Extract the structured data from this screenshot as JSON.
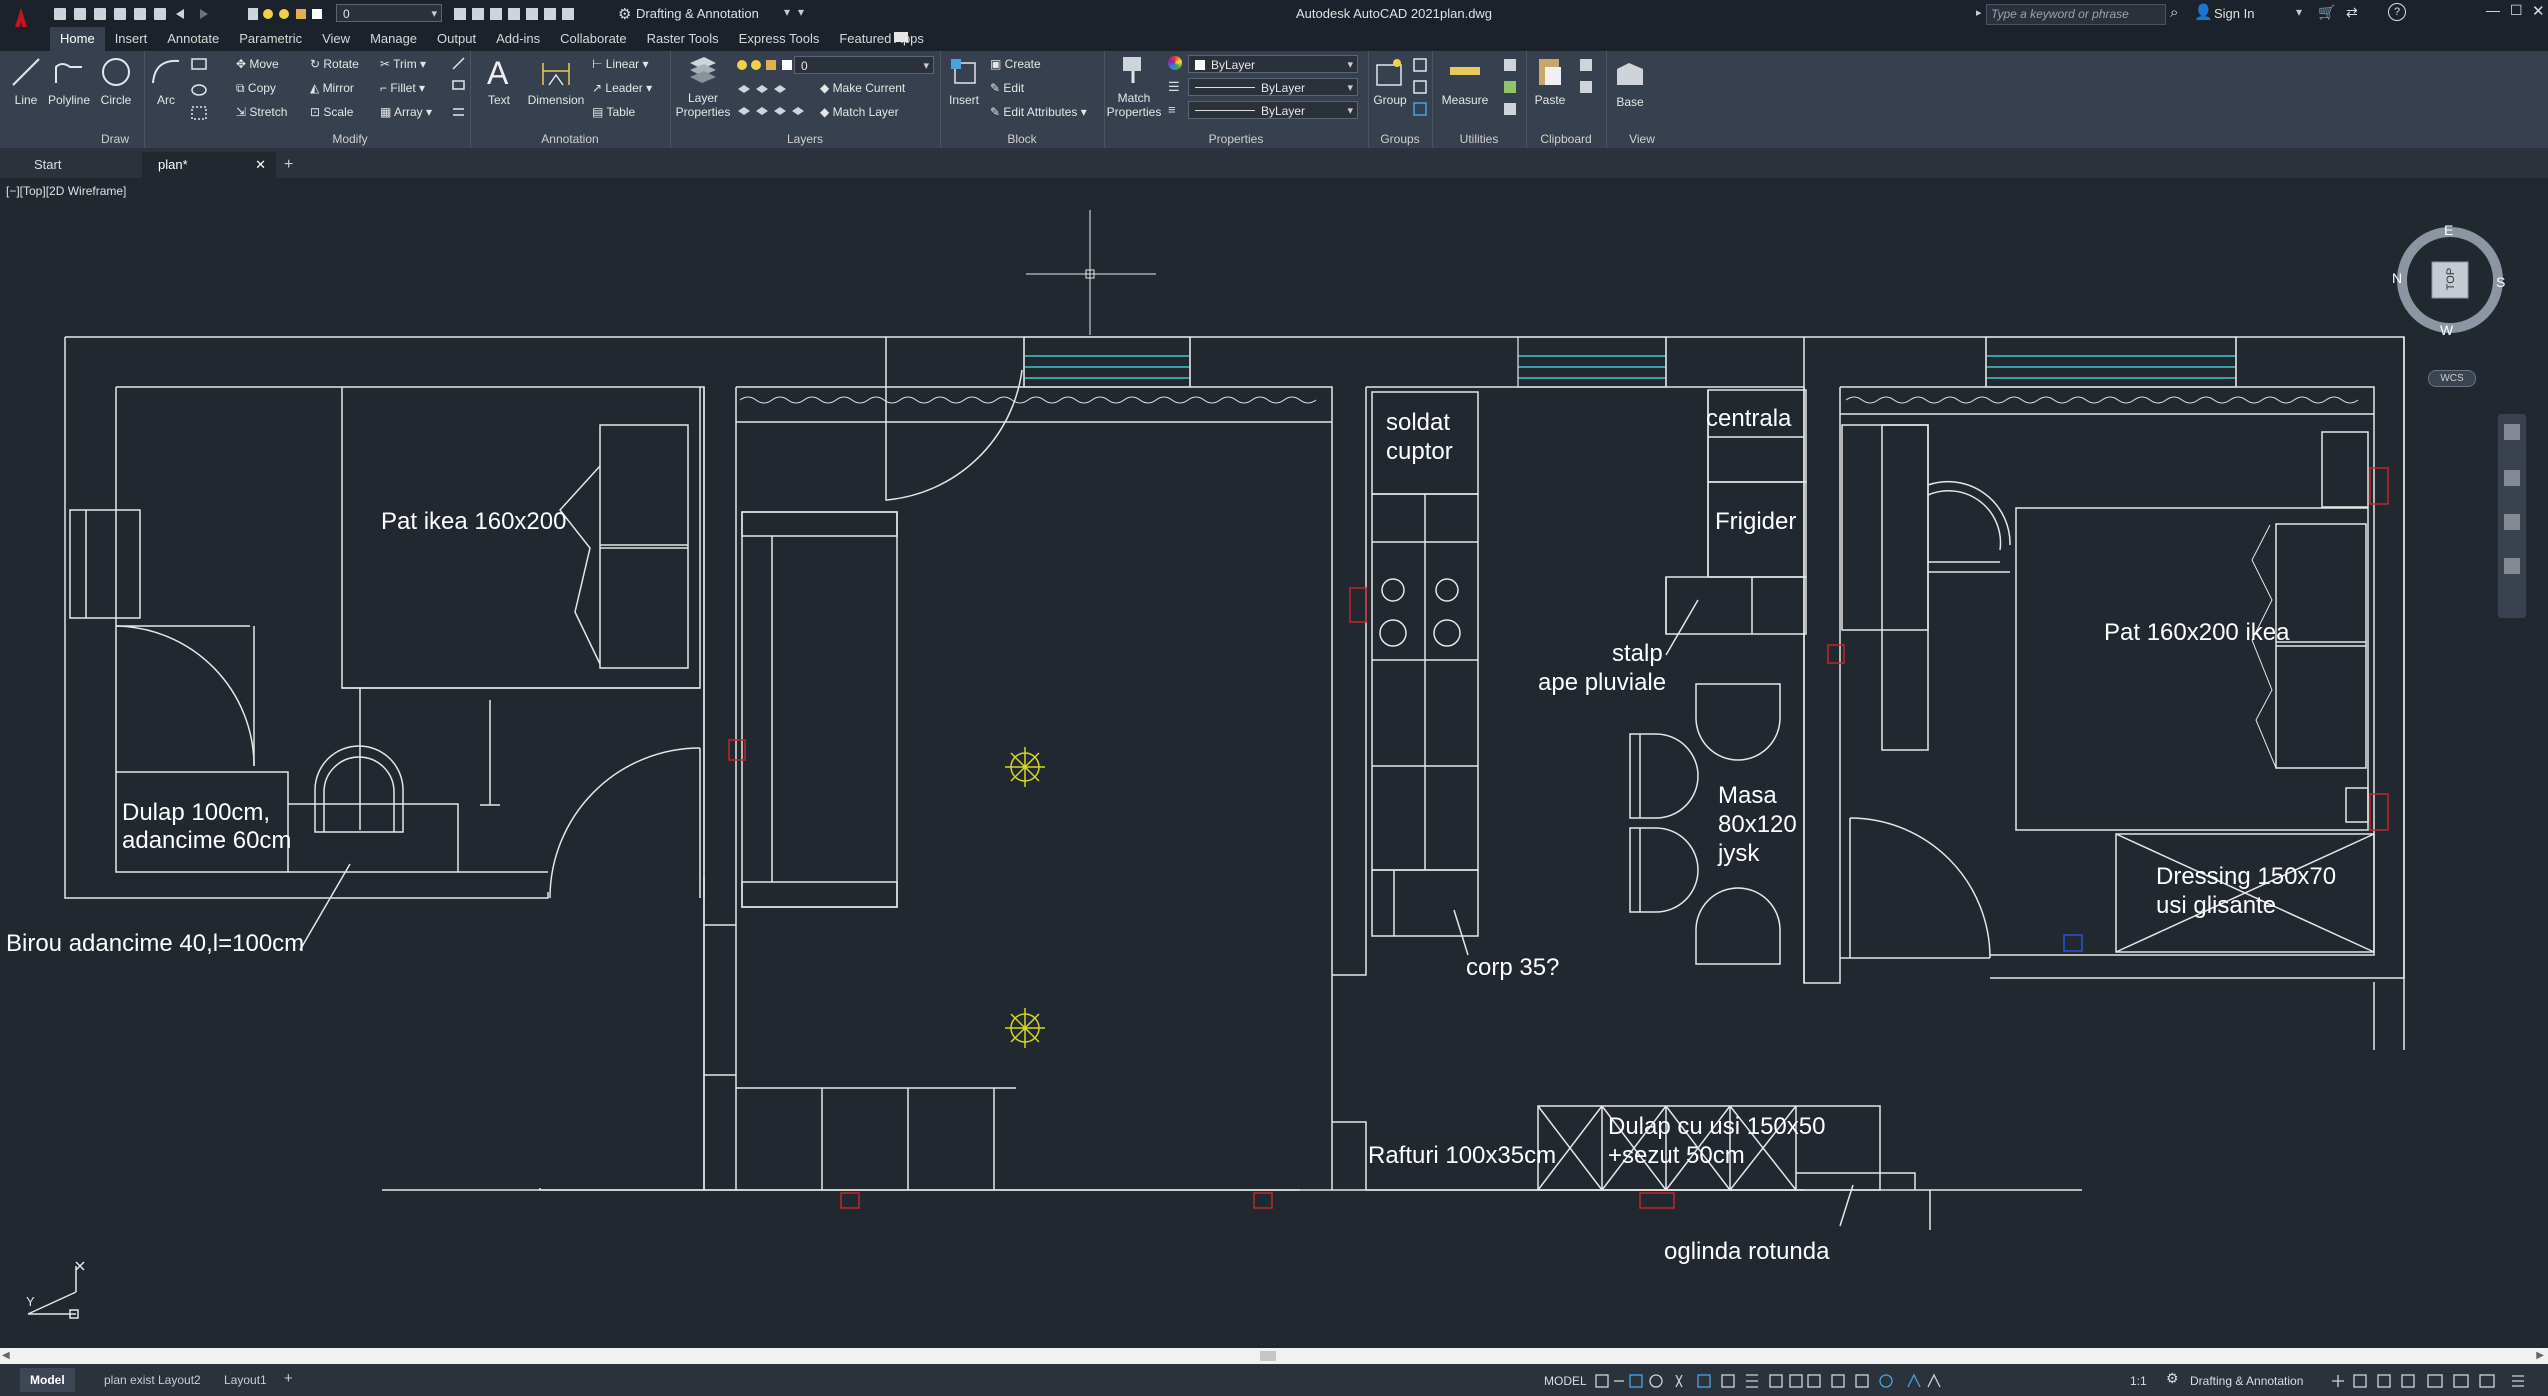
{
  "titlebar": {
    "app_title": "Autodesk AutoCAD 2021",
    "file_name": "plan.dwg",
    "layer_value": "0",
    "workspace": "Drafting & Annotation",
    "search_placeholder": "Type a keyword or phrase",
    "sign_in": "Sign In"
  },
  "ribbon_tabs": [
    "Home",
    "Insert",
    "Annotate",
    "Parametric",
    "View",
    "Manage",
    "Output",
    "Add-ins",
    "Collaborate",
    "Raster Tools",
    "Express Tools",
    "Featured Apps"
  ],
  "ribbon": {
    "draw": {
      "title": "Draw",
      "line": "Line",
      "polyline": "Polyline",
      "circle": "Circle",
      "arc": "Arc"
    },
    "modify": {
      "title": "Modify",
      "move": "Move",
      "rotate": "Rotate",
      "trim": "Trim",
      "copy": "Copy",
      "mirror": "Mirror",
      "fillet": "Fillet",
      "stretch": "Stretch",
      "scale": "Scale",
      "array": "Array"
    },
    "annotation": {
      "title": "Annotation",
      "text": "Text",
      "dimension": "Dimension",
      "linear": "Linear",
      "leader": "Leader",
      "table": "Table"
    },
    "layers": {
      "title": "Layers",
      "layer_properties_1": "Layer",
      "layer_properties_2": "Properties",
      "layer_value": "0",
      "make_current": "Make Current",
      "match_layer": "Match Layer"
    },
    "block": {
      "title": "Block",
      "insert": "Insert",
      "create": "Create",
      "edit": "Edit",
      "edit_attributes": "Edit Attributes"
    },
    "properties": {
      "title": "Properties",
      "match_1": "Match",
      "match_2": "Properties",
      "color": "ByLayer",
      "linetype": "ByLayer",
      "lineweight": "ByLayer"
    },
    "groups": {
      "title": "Groups",
      "group": "Group"
    },
    "utilities": {
      "title": "Utilities",
      "measure": "Measure"
    },
    "clipboard": {
      "title": "Clipboard",
      "paste": "Paste"
    },
    "view": {
      "title": "View",
      "base": "Base"
    }
  },
  "doc_tabs": {
    "start": "Start",
    "plan": "plan*"
  },
  "viewport_label": "[−][Top][2D Wireframe]",
  "viewcube": {
    "top": "TOP",
    "n": "N",
    "e": "E",
    "s": "S",
    "w": "W",
    "wcs": "WCS"
  },
  "ucs": {
    "x": "X",
    "y": "Y"
  },
  "drawing_labels": {
    "pat_ikea": "Pat ikea 160x200",
    "dulap_1": "Dulap 100cm,",
    "dulap_2": "adancime 60cm",
    "birou": "Birou adancime 40,l=100cm",
    "soldat_1": "soldat",
    "soldat_2": "cuptor",
    "centrala": "centrala",
    "frigider": "Frigider",
    "stalp_1": "stalp",
    "stalp_2": "ape pluviale",
    "masa_1": "Masa",
    "masa_2": "80x120",
    "masa_3": "jysk",
    "corp": "corp 35?",
    "pat_160": "Pat 160x200 ikea",
    "dressing_1": "Dressing 150x70",
    "dressing_2": "usi glisante",
    "rafturi": "Rafturi 100x35cm",
    "dulap_usi_1": "Dulap cu usi 150x50",
    "dulap_usi_2": "+sezut 50cm",
    "oglinda": "oglinda rotunda"
  },
  "status_tabs": [
    "Model",
    "plan exist",
    "Layout2",
    "Layout1"
  ],
  "status": {
    "model": "MODEL",
    "scale": "1:1",
    "workspace": "Drafting & Annotation"
  },
  "colors": {
    "background": "#212830",
    "linework": "#e6e6e6",
    "cyan_window": "#3ec8c8",
    "red_block": "#c0262c",
    "yellow_light": "#d6d62a",
    "app_red": "#c8141e"
  }
}
